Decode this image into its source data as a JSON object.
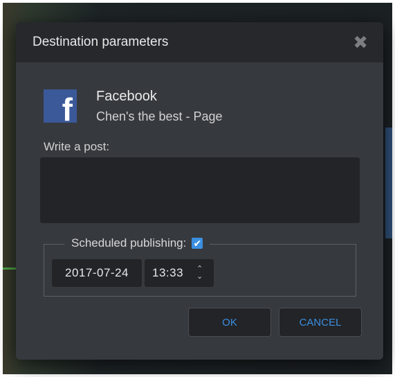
{
  "dialog": {
    "title": "Destination parameters",
    "close_glyph": "✖"
  },
  "destination": {
    "icon": "facebook-icon",
    "icon_glyph": "f",
    "name": "Facebook",
    "page": "Chen's the best - Page"
  },
  "post": {
    "label": "Write a post:",
    "value": ""
  },
  "schedule": {
    "label": "Scheduled publishing:",
    "checked": true,
    "check_glyph": "✔",
    "date": "2017-07-24",
    "time": "13:33",
    "spinner_up": "⌃",
    "spinner_down": "⌄"
  },
  "buttons": {
    "ok": "OK",
    "cancel": "CANCEL"
  },
  "colors": {
    "accent": "#3b8fe0",
    "facebook": "#3b5998",
    "dialog_bg": "#36393e",
    "header_bg": "#26282c"
  }
}
